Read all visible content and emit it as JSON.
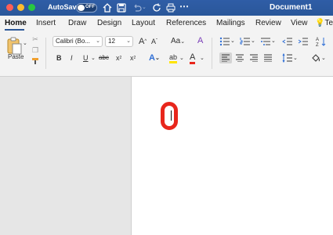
{
  "titlebar": {
    "autosave_label": "AutoSave",
    "toggle_state": "OFF",
    "document_title": "Document1"
  },
  "tabs": [
    "Home",
    "Insert",
    "Draw",
    "Design",
    "Layout",
    "References",
    "Mailings",
    "Review",
    "View",
    "Te"
  ],
  "ribbon": {
    "paste_label": "Paste",
    "font_name": "Calibri (Bo...",
    "font_size": "12",
    "grow_font": "A",
    "shrink_font": "A",
    "change_case": "Aa",
    "clear_format": "A",
    "bold": "B",
    "italic": "I",
    "underline": "U",
    "strike": "abc",
    "subscript": "x",
    "superscript": "x",
    "text_effects": "A",
    "highlight": "ab",
    "font_color": "A"
  },
  "document": {
    "content": "0"
  }
}
